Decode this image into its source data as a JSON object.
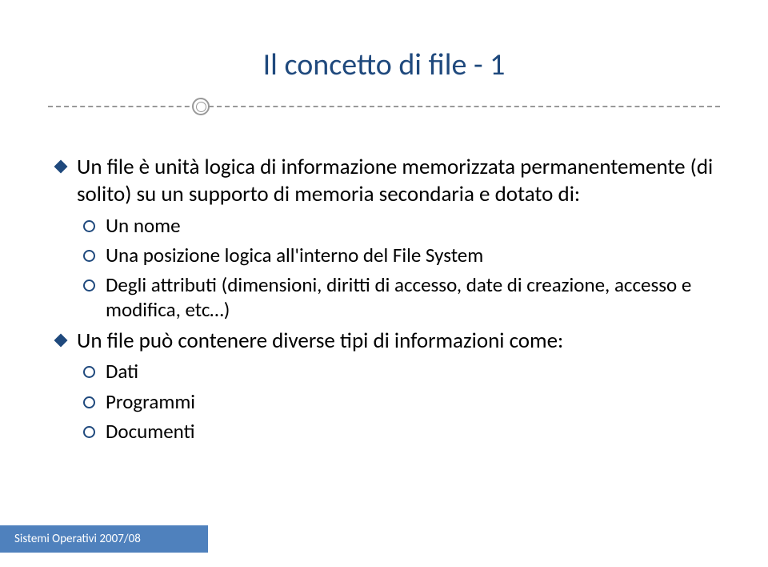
{
  "title": "Il concetto di file - 1",
  "bullets": {
    "b1": "Un file è unità logica di informazione memorizzata permanentemente (di solito) su un supporto di memoria secondaria e dotato di:",
    "b1_1": "Un nome",
    "b1_2": "Una posizione logica all'interno del File System",
    "b1_3": "Degli attributi (dimensioni, diritti di accesso, date di creazione, accesso e modifica, etc…)",
    "b2": "Un file può contenere diverse tipi di informazioni come:",
    "b2_1": "Dati",
    "b2_2": "Programmi",
    "b2_3": "Documenti"
  },
  "footer": "Sistemi Operativi 2007/08"
}
